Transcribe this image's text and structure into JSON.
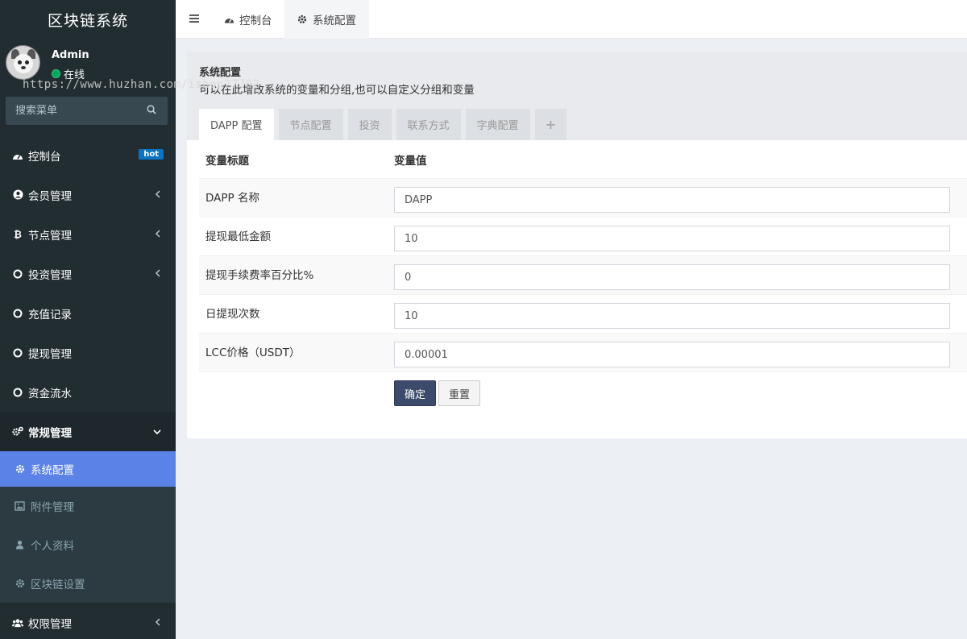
{
  "app": {
    "title": "区块链系统"
  },
  "watermark": "https://www.huzhan.com/ishop27702",
  "user": {
    "name": "Admin",
    "status": "在线"
  },
  "search": {
    "placeholder": "搜索菜单"
  },
  "menu": {
    "dashboard": {
      "label": "控制台",
      "badge": "hot"
    },
    "members": {
      "label": "会员管理"
    },
    "nodes": {
      "label": "节点管理"
    },
    "invest": {
      "label": "投资管理"
    },
    "recharge": {
      "label": "充值记录"
    },
    "withdraw": {
      "label": "提现管理"
    },
    "flow": {
      "label": "资金流水"
    },
    "general": {
      "label": "常规管理",
      "items": [
        {
          "label": "系统配置"
        },
        {
          "label": "附件管理"
        },
        {
          "label": "个人资料"
        },
        {
          "label": "区块链设置"
        }
      ]
    },
    "permissions": {
      "label": "权限管理"
    }
  },
  "topbar": {
    "tabs": [
      {
        "label": "控制台"
      },
      {
        "label": "系统配置"
      }
    ]
  },
  "panel": {
    "title": "系统配置",
    "desc": "可以在此增改系统的变量和分组,也可以自定义分组和变量",
    "tabs": [
      "DAPP 配置",
      "节点配置",
      "投资",
      "联系方式",
      "字典配置",
      "+"
    ]
  },
  "form": {
    "headers": {
      "label": "变量标题",
      "value": "变量值"
    },
    "rows": [
      {
        "label": "DAPP 名称",
        "value": "DAPP"
      },
      {
        "label": "提现最低金额",
        "value": "10"
      },
      {
        "label": "提现手续费率百分比%",
        "value": "0"
      },
      {
        "label": "日提现次数",
        "value": "10"
      },
      {
        "label": "LCC价格（USDT）",
        "value": "0.00001"
      }
    ],
    "submit_label": "确定",
    "reset_label": "重置"
  }
}
